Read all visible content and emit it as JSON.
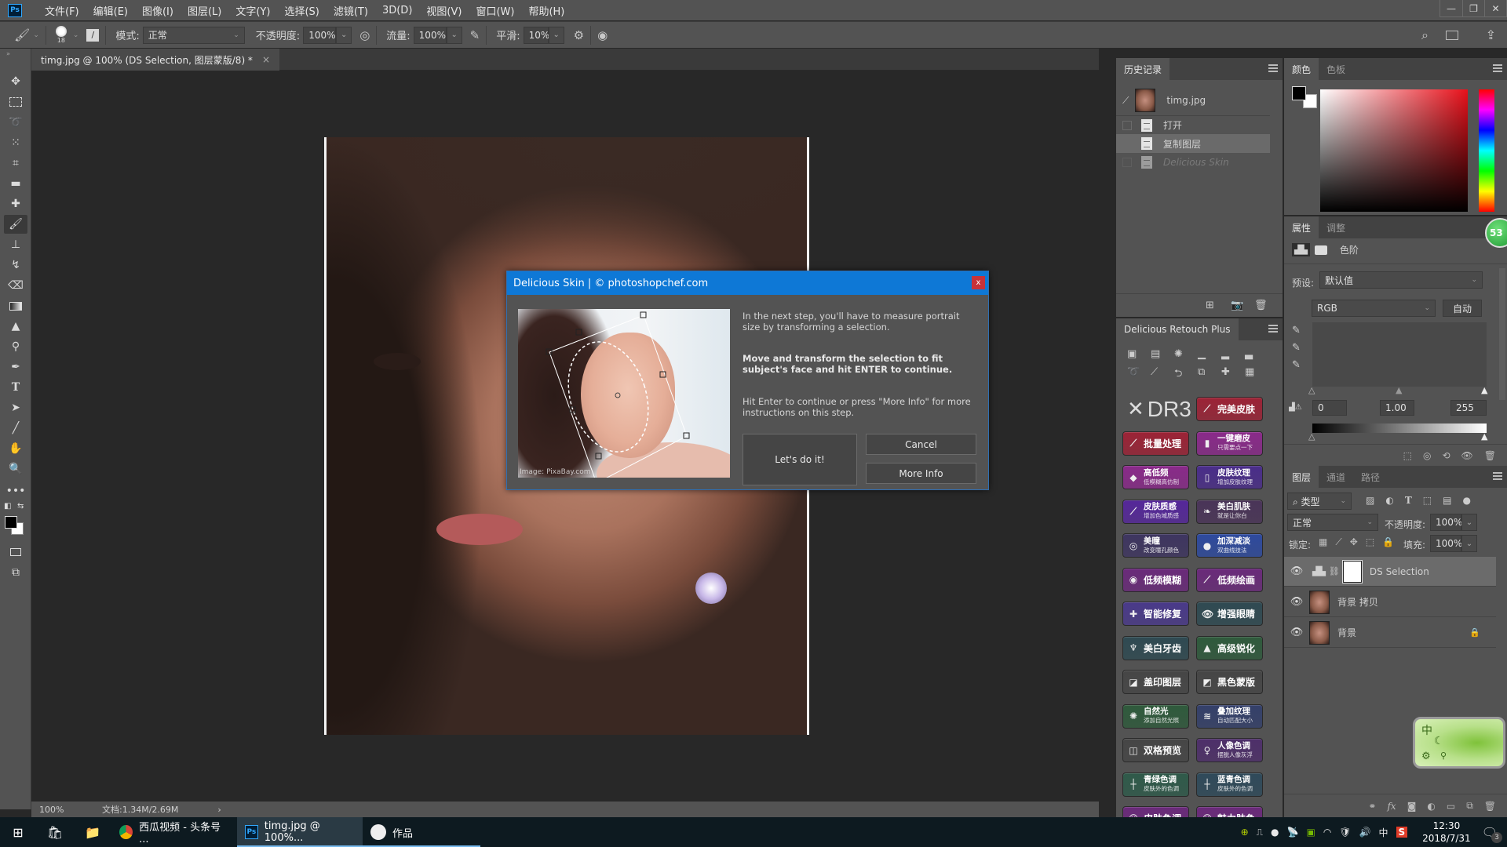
{
  "app": {
    "logo": "Ps"
  },
  "menubar": {
    "items": [
      "文件(F)",
      "编辑(E)",
      "图像(I)",
      "图层(L)",
      "文字(Y)",
      "选择(S)",
      "滤镜(T)",
      "3D(D)",
      "视图(V)",
      "窗口(W)",
      "帮助(H)"
    ],
    "window_controls": {
      "minimize": "—",
      "restore": "❐",
      "close": "✕"
    }
  },
  "options_bar": {
    "brush_size": "18",
    "mode_label": "模式:",
    "mode_value": "正常",
    "opacity_label": "不透明度:",
    "opacity_value": "100%",
    "flow_label": "流量:",
    "flow_value": "100%",
    "smoothing_label": "平滑:",
    "smoothing_value": "10%"
  },
  "document": {
    "tab_title": "timg.jpg @ 100% (DS Selection, 图层蒙版/8) *",
    "close": "×",
    "zoom": "100%",
    "doc_size": "文档:1.34M/2.69M",
    "status_arrow": "›"
  },
  "dialog": {
    "title": "Delicious Skin | © photoshopchef.com",
    "close": "x",
    "image_credit": "Image: PixaBay.com",
    "para1": "In the next step, you'll have to measure portrait size by transforming a selection.",
    "para2": "Move and transform the selection to fit subject's face and hit ENTER to continue.",
    "para3": "Hit Enter to continue or press \"More Info\" for more instructions on this step.",
    "primary_button": "Let's do it!",
    "cancel_button": "Cancel",
    "more_info_button": "More Info"
  },
  "history": {
    "tab": "历史记录",
    "snapshot": "timg.jpg",
    "items": [
      {
        "label": "打开",
        "state": "normal"
      },
      {
        "label": "复制图层",
        "state": "selected"
      },
      {
        "label": "Delicious Skin",
        "state": "dimmed"
      }
    ]
  },
  "retouch": {
    "tab": "Delicious Retouch Plus",
    "logo": "DR3",
    "buttons": [
      {
        "label": "完美皮肤",
        "sub": "",
        "icon": "brush",
        "color": "#9c2336"
      },
      {
        "label": "批量处理",
        "sub": "",
        "icon": "brush",
        "color": "#9c2336"
      },
      {
        "label": "一键磨皮",
        "sub": "只需要点一下",
        "icon": "bottle",
        "color": "#8a2a8a"
      },
      {
        "label": "高低频",
        "sub": "低模糊高仿制",
        "icon": "diamond",
        "color": "#8a2a8a"
      },
      {
        "label": "皮肤纹理",
        "sub": "增加皮肤纹理",
        "icon": "spray",
        "color": "#4a2d8a"
      },
      {
        "label": "皮肤质感",
        "sub": "增加色域质感",
        "icon": "brush",
        "color": "#55279a"
      },
      {
        "label": "美白肌肤",
        "sub": "就是让你白",
        "icon": "feather",
        "color": "#4a3458"
      },
      {
        "label": "美瞳",
        "sub": "改变瞳孔颜色",
        "icon": "eye-circle",
        "color": "#3e3560"
      },
      {
        "label": "加深减淡",
        "sub": "双曲线技法",
        "icon": "sphere",
        "color": "#2e4a9e"
      },
      {
        "label": "低频模糊",
        "sub": "",
        "icon": "blur",
        "color": "#6a2a7a"
      },
      {
        "label": "低频绘画",
        "sub": "",
        "icon": "brush",
        "color": "#6a2a7a"
      },
      {
        "label": "智能修复",
        "sub": "",
        "icon": "bandage",
        "color": "#4a3a8a"
      },
      {
        "label": "增强眼睛",
        "sub": "",
        "icon": "eye",
        "color": "#2f4a52"
      },
      {
        "label": "美白牙齿",
        "sub": "",
        "icon": "tooth",
        "color": "#2f4a52"
      },
      {
        "label": "高级锐化",
        "sub": "",
        "icon": "triangle",
        "color": "#2f5a3c"
      },
      {
        "label": "盖印图层",
        "sub": "",
        "icon": "stamp-layer",
        "color": "#464646"
      },
      {
        "label": "黑色蒙版",
        "sub": "",
        "icon": "mask",
        "color": "#464646"
      },
      {
        "label": "自然光",
        "sub": "添加自然光照",
        "icon": "sun",
        "color": "#2f5a3c"
      },
      {
        "label": "叠加纹理",
        "sub": "自动匹配大小",
        "icon": "waves",
        "color": "#34406a"
      },
      {
        "label": "双格预览",
        "sub": "",
        "icon": "split",
        "color": "#464646"
      },
      {
        "label": "人像色调",
        "sub": "摆脱人像灰浮",
        "icon": "figure",
        "color": "#4e2f6a"
      },
      {
        "label": "青绿色调",
        "sub": "皮肤外的色调",
        "icon": "cross",
        "color": "#2f5a4a"
      },
      {
        "label": "蓝青色调",
        "sub": "皮肤外的色调",
        "icon": "cross",
        "color": "#2f4a5a"
      },
      {
        "label": "皮肤色调",
        "sub": "",
        "icon": "person",
        "color": "#6a2a7a"
      },
      {
        "label": "魅力肤色",
        "sub": "",
        "icon": "person",
        "color": "#6a2a7a"
      }
    ]
  },
  "color_panel": {
    "tabs": [
      "颜色",
      "色板"
    ],
    "foreground": "#000000",
    "background": "#ffffff",
    "hue_color": "#e8101a"
  },
  "properties": {
    "tabs": [
      "属性",
      "调整"
    ],
    "adjustment": "色阶",
    "preset_label": "预设:",
    "preset_value": "默认值",
    "channel": "RGB",
    "auto_button": "自动",
    "input_black": "0",
    "input_gamma": "1.00",
    "input_white": "255",
    "badge": "53"
  },
  "layers": {
    "tabs": [
      "图层",
      "通道",
      "路径"
    ],
    "filter": "类型",
    "blend_mode": "正常",
    "opacity_label": "不透明度:",
    "opacity": "100%",
    "lock_label": "锁定:",
    "fill_label": "填充:",
    "fill": "100%",
    "items": [
      {
        "name": "DS Selection",
        "type": "levels-adjustment",
        "selected": true
      },
      {
        "name": "背景 拷贝",
        "type": "image",
        "selected": false
      },
      {
        "name": "背景",
        "type": "image",
        "selected": false,
        "locked": true
      }
    ]
  },
  "ime": {
    "lang": "中"
  },
  "taskbar": {
    "apps": [
      {
        "label": "西瓜视频 - 头条号 ...",
        "icon": "chrome-icon",
        "active": false
      },
      {
        "label": "timg.jpg @ 100%...",
        "icon": "photoshop-icon",
        "active": true
      },
      {
        "label": "作品",
        "icon": "app-icon",
        "active": false
      }
    ],
    "tray_lang": "中",
    "time": "12:30",
    "date": "2018/7/31",
    "notifications": "3"
  }
}
